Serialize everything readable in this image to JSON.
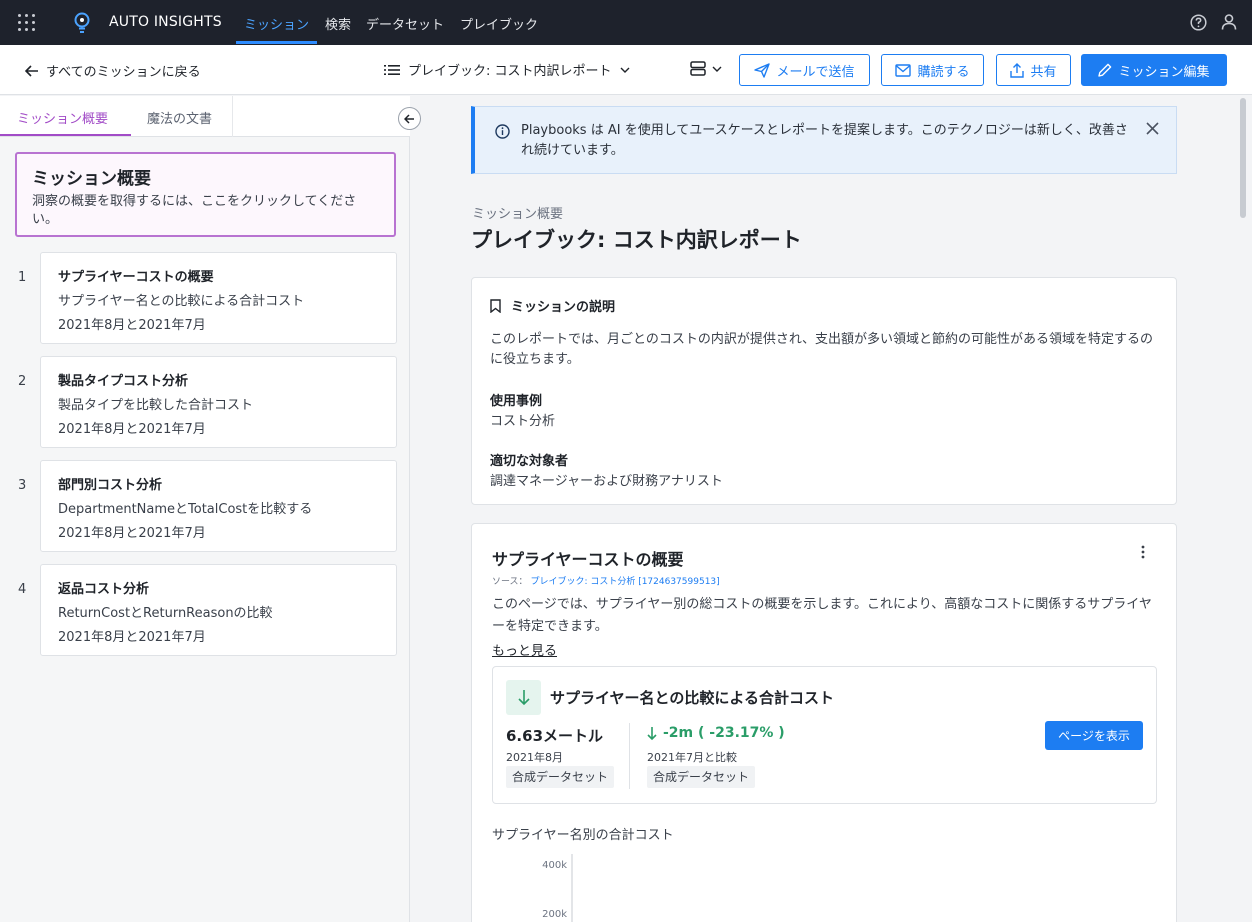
{
  "topnav": {
    "brand": "AUTO INSIGHTS",
    "items": [
      {
        "label": "ミッション",
        "active": true
      },
      {
        "label": "検索",
        "active": false
      },
      {
        "label": "データセット",
        "active": false
      },
      {
        "label": "プレイブック",
        "active": false
      }
    ],
    "icons": [
      "apps-grid-icon",
      "lightbulb-logo-icon",
      "help-icon",
      "user-icon"
    ]
  },
  "subbar": {
    "back_label": "すべてのミッションに戻る",
    "playbook_label": "プレイブック: コスト内訳レポート",
    "buttons": {
      "email": "メールで送信",
      "subscribe": "購読する",
      "share": "共有",
      "edit": "ミッション編集"
    }
  },
  "sidebar": {
    "tabs": [
      {
        "label": "ミッション概要",
        "active": true
      },
      {
        "label": "魔法の文書",
        "active": false
      }
    ],
    "overview": {
      "title": "ミッション概要",
      "description": "洞察の概要を取得するには、ここをクリックしてください。"
    },
    "missions": [
      {
        "number": "1",
        "title": "サプライヤーコストの概要",
        "desc": "サプライヤー名との比較による合計コスト",
        "period": "2021年8月と2021年7月"
      },
      {
        "number": "2",
        "title": "製品タイプコスト分析",
        "desc": "製品タイプを比較した合計コスト",
        "period": "2021年8月と2021年7月"
      },
      {
        "number": "3",
        "title": "部門別コスト分析",
        "desc": "DepartmentNameとTotalCostを比較する",
        "period": "2021年8月と2021年7月"
      },
      {
        "number": "4",
        "title": "返品コスト分析",
        "desc": "ReturnCostとReturnReasonの比較",
        "period": "2021年8月と2021年7月"
      }
    ]
  },
  "main": {
    "banner": "Playbooks は AI を使用してユースケースとレポートを提案します。このテクノロジーは新しく、改善され続けています。",
    "breadcrumb": "ミッション概要",
    "title": "プレイブック: コスト内訳レポート",
    "description_card": {
      "header": "ミッションの説明",
      "body": "このレポートでは、月ごとのコストの内訳が提供され、支出額が多い領域と節約の可能性がある領域を特定するのに役立ちます。",
      "use_case_label": "使用事例",
      "use_case": "コスト分析",
      "audience_label": "適切な対象者",
      "audience": "調達マネージャーおよび財務アナリスト"
    },
    "supplier_card": {
      "title": "サプライヤーコストの概要",
      "source_prefix": "ソース：",
      "source_link": "プレイブック: コスト分析 [1724637599513]",
      "description": "このページでは、サプライヤー別の総コストの概要を示します。これにより、高額なコストに関係するサプライヤーを特定できます。",
      "more": "もっと見る",
      "metric": {
        "title": "サプライヤー名との比較による合計コスト",
        "value": "6.63メートル",
        "value_period": "2021年8月",
        "value_chip": "合成データセット",
        "delta": "-2m ( -23.17% )",
        "delta_period": "2021年7月と比較",
        "delta_chip": "合成データセット",
        "view_button": "ページを表示"
      },
      "chart_title": "サプライヤー名別の合計コスト",
      "y_ticks": [
        "400k",
        "200k"
      ]
    }
  },
  "colors": {
    "accent": "#1d7df2",
    "nav_bg": "#1e222c",
    "tab_active": "#a24cc7",
    "positive_delta": "#2a9d68"
  }
}
